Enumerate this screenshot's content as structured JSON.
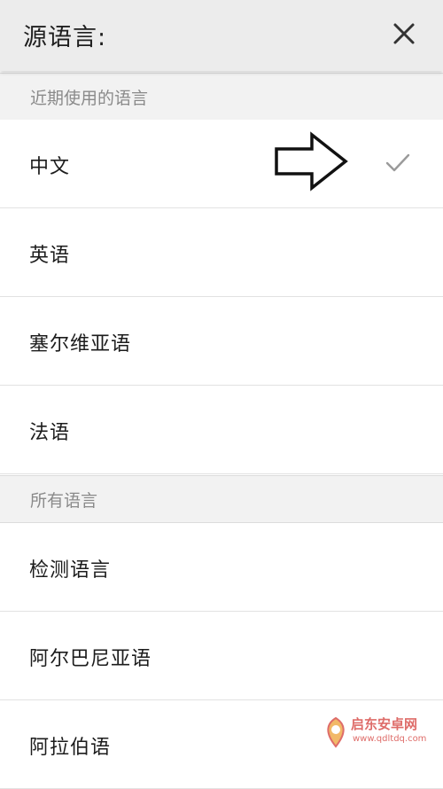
{
  "header": {
    "title": "源语言:"
  },
  "sections": {
    "recent": {
      "title": "近期使用的语言"
    },
    "all": {
      "title": "所有语言"
    }
  },
  "recent_languages": [
    {
      "label": "中文",
      "selected": true
    },
    {
      "label": "英语",
      "selected": false
    },
    {
      "label": "塞尔维亚语",
      "selected": false
    },
    {
      "label": "法语",
      "selected": false
    }
  ],
  "all_languages": [
    {
      "label": "检测语言"
    },
    {
      "label": "阿尔巴尼亚语"
    },
    {
      "label": "阿拉伯语"
    }
  ],
  "icons": {
    "close": "close-icon",
    "check": "checkmark-icon",
    "pointer": "right-arrow-annotation"
  },
  "watermark": {
    "brand": "启东安卓网",
    "url": "www.qdltdq.com"
  },
  "colors": {
    "header_bg": "#ececec",
    "section_bg": "#f2f2f2",
    "check": "#9a9a9a"
  }
}
